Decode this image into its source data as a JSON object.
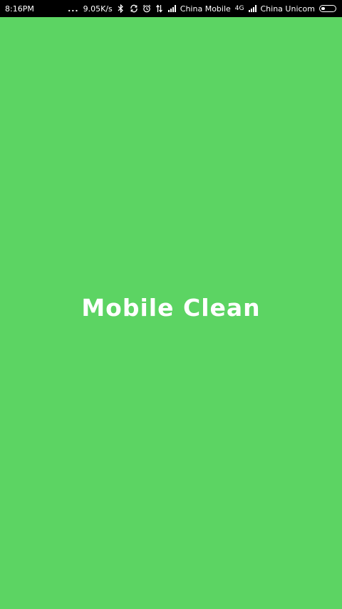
{
  "status_bar": {
    "time": "8:16PM",
    "dots": "...",
    "network_speed": "9.05K/s",
    "carrier_1": "China Mobile",
    "network_type": "4G",
    "carrier_2": "China Unicom",
    "icons": [
      "bluetooth-icon",
      "sync-icon",
      "alarm-icon",
      "data-transfer-icon",
      "signal-icon",
      "signal-icon",
      "battery-icon"
    ]
  },
  "splash": {
    "title": "Mobile Clean"
  },
  "colors": {
    "background": "#5cd463",
    "status_bar": "#000000",
    "text": "#ffffff"
  }
}
